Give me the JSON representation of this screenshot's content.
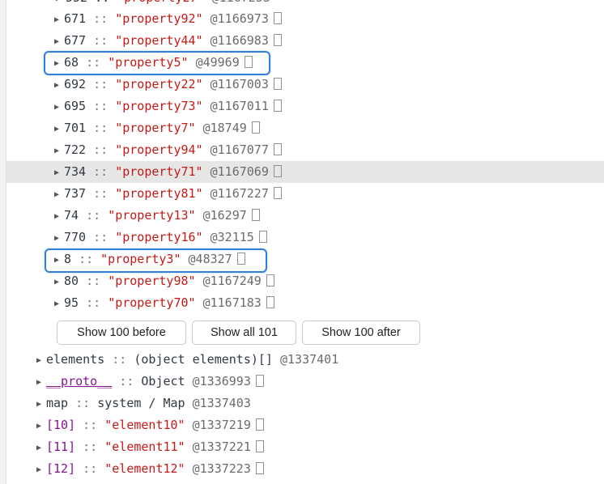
{
  "rows": [
    {
      "key": "671",
      "sep": "::",
      "val": "\"property92\"",
      "id": "@1166973"
    },
    {
      "key": "677",
      "sep": "::",
      "val": "\"property44\"",
      "id": "@1166983"
    },
    {
      "key": "68",
      "sep": "::",
      "val": "\"property5\"",
      "id": "@49969"
    },
    {
      "key": "692",
      "sep": "::",
      "val": "\"property22\"",
      "id": "@1167003"
    },
    {
      "key": "695",
      "sep": "::",
      "val": "\"property73\"",
      "id": "@1167011"
    },
    {
      "key": "701",
      "sep": "::",
      "val": "\"property7\"",
      "id": "@18749"
    },
    {
      "key": "722",
      "sep": "::",
      "val": "\"property94\"",
      "id": "@1167077"
    },
    {
      "key": "734",
      "sep": "::",
      "val": "\"property71\"",
      "id": "@1167069"
    },
    {
      "key": "737",
      "sep": "::",
      "val": "\"property81\"",
      "id": "@1167227"
    },
    {
      "key": "74",
      "sep": "::",
      "val": "\"property13\"",
      "id": "@16297"
    },
    {
      "key": "770",
      "sep": "::",
      "val": "\"property16\"",
      "id": "@32115"
    },
    {
      "key": "8",
      "sep": "::",
      "val": "\"property3\"",
      "id": "@48327"
    },
    {
      "key": "80",
      "sep": "::",
      "val": "\"property98\"",
      "id": "@1167249"
    },
    {
      "key": "95",
      "sep": "::",
      "val": "\"property70\"",
      "id": "@1167183"
    }
  ],
  "buttons": {
    "before": "Show 100 before",
    "all": "Show all 101",
    "after": "Show 100 after"
  },
  "outer": [
    {
      "key": "elements",
      "sep": "::",
      "val": "(object elements)[]",
      "id": "@1337401"
    },
    {
      "key": "__proto__",
      "sep": "::",
      "val": "Object",
      "id": "@1336993"
    },
    {
      "key": "map",
      "sep": "::",
      "val": "system / Map",
      "id": "@1337403"
    },
    {
      "key": "[10]",
      "sep": "::",
      "val": "\"element10\"",
      "id": "@1337219"
    },
    {
      "key": "[11]",
      "sep": "::",
      "val": "\"element11\"",
      "id": "@1337221"
    },
    {
      "key": "[12]",
      "sep": "::",
      "val": "\"element12\"",
      "id": "@1337223"
    }
  ],
  "icons": {
    "expand": "triangle-right-icon",
    "reveal": "reveal-box-icon"
  },
  "colors": {
    "string": "#c41a16",
    "purple": "#881391",
    "highlight": "#2f7fdb",
    "selected_row": "#e6e6e6"
  }
}
